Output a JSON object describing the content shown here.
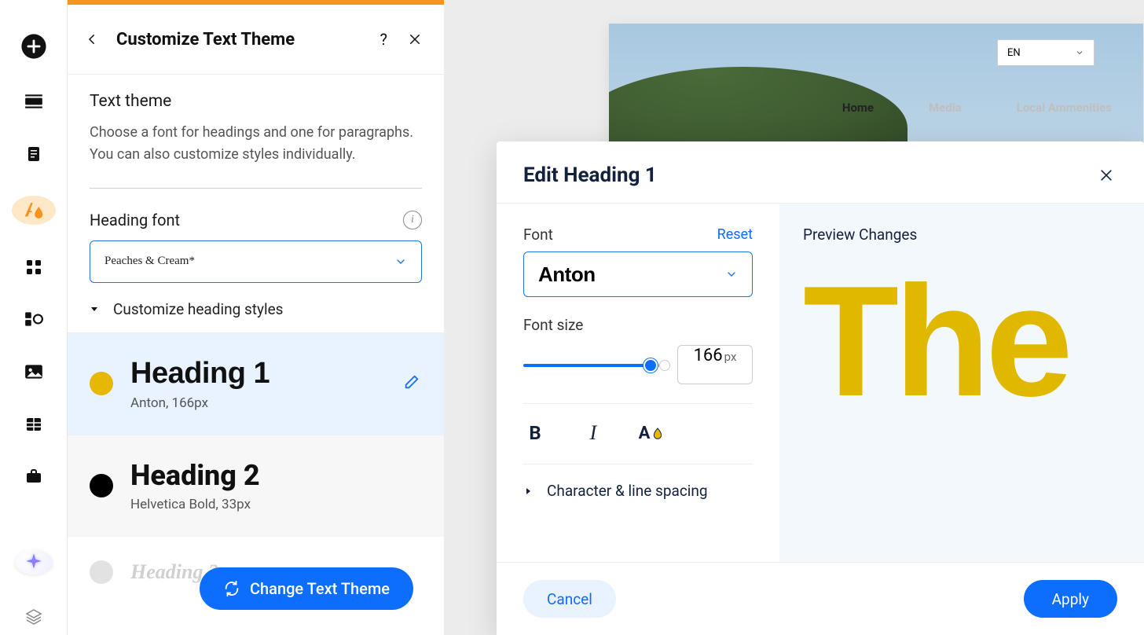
{
  "rail": {
    "items": [
      "add",
      "section",
      "page",
      "theme",
      "apps",
      "widgets",
      "media",
      "table",
      "business"
    ]
  },
  "sidebar": {
    "title": "Customize Text Theme",
    "section_title": "Text theme",
    "section_desc": "Choose a font for headings and one for paragraphs. You can also customize styles individually.",
    "heading_font_label": "Heading font",
    "heading_font_value": "Peaches & Cream*",
    "customize_toggle": "Customize heading styles",
    "headings": [
      {
        "title": "Heading 1",
        "sub": "Anton, 166px",
        "dot": "yellow",
        "cls": "h1",
        "selected": true
      },
      {
        "title": "Heading 2",
        "sub": "Helvetica Bold, 33px",
        "dot": "black",
        "cls": "h2",
        "selected": false
      },
      {
        "title": "Heading 3",
        "sub": "",
        "dot": "grey",
        "cls": "h3",
        "selected": false
      }
    ],
    "change_theme_btn": "Change Text Theme"
  },
  "page": {
    "lang": "EN",
    "nav": [
      {
        "label": "Home",
        "active": true
      },
      {
        "label": "Media",
        "active": false
      },
      {
        "label": "Local Ammenities",
        "active": false
      }
    ]
  },
  "dialog": {
    "title": "Edit Heading 1",
    "font_label": "Font",
    "reset": "Reset",
    "font_value": "Anton",
    "size_label": "Font size",
    "size_value": "166",
    "size_unit": "px",
    "spacing_label": "Character & line spacing",
    "preview_label": "Preview Changes",
    "preview_text": "The",
    "cancel": "Cancel",
    "apply": "Apply"
  }
}
